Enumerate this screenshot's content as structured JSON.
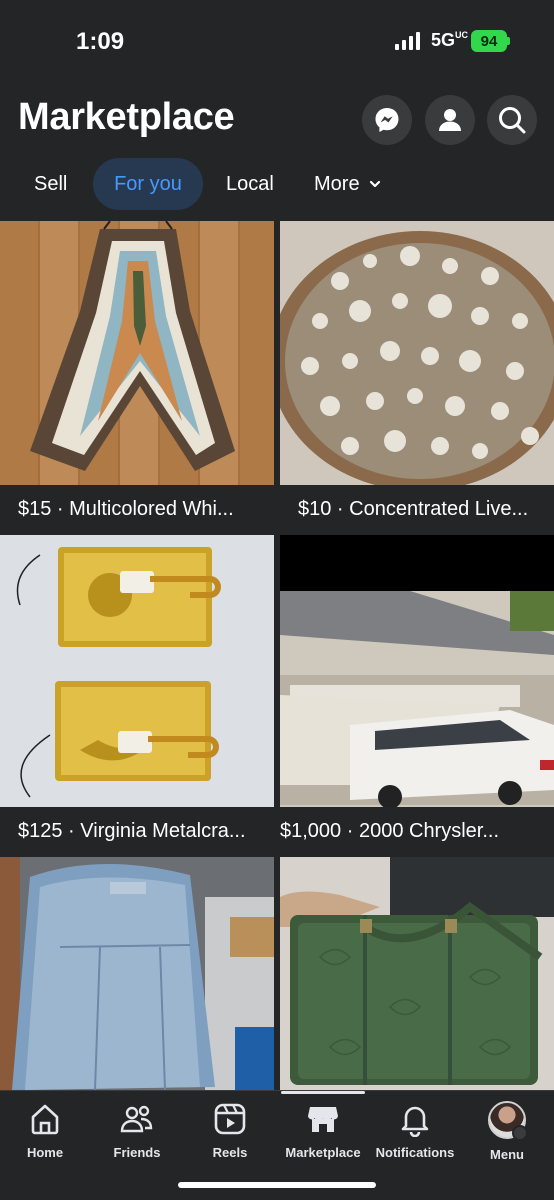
{
  "status_bar": {
    "time": "1:09",
    "network": "5G",
    "network_suffix": "UC",
    "battery": "94"
  },
  "header": {
    "title": "Marketplace",
    "icons": [
      "messenger-icon",
      "profile-icon",
      "search-icon"
    ]
  },
  "tabs": [
    {
      "label": "Sell"
    },
    {
      "label": "For you",
      "selected": true
    },
    {
      "label": "Local"
    },
    {
      "label": "More"
    }
  ],
  "listings": [
    {
      "caption": "$15 · Multicolored Whi..."
    },
    {
      "caption": "$10 · Concentrated Live..."
    },
    {
      "caption": "$125 · Virginia Metalcra..."
    },
    {
      "caption": "$1,000 · 2000 Chrysler..."
    },
    {
      "caption": ""
    },
    {
      "caption": ""
    }
  ],
  "bottom_nav": [
    {
      "label": "Home",
      "icon": "home-icon"
    },
    {
      "label": "Friends",
      "icon": "friends-icon"
    },
    {
      "label": "Reels",
      "icon": "reels-icon"
    },
    {
      "label": "Marketplace",
      "icon": "marketplace-icon",
      "active": true
    },
    {
      "label": "Notifications",
      "icon": "bell-icon"
    },
    {
      "label": "Menu",
      "icon": "avatar"
    }
  ],
  "colors": {
    "background": "#242526",
    "accent": "#4599ff",
    "selected_tab_bg": "#263951",
    "battery": "#32d74b"
  }
}
